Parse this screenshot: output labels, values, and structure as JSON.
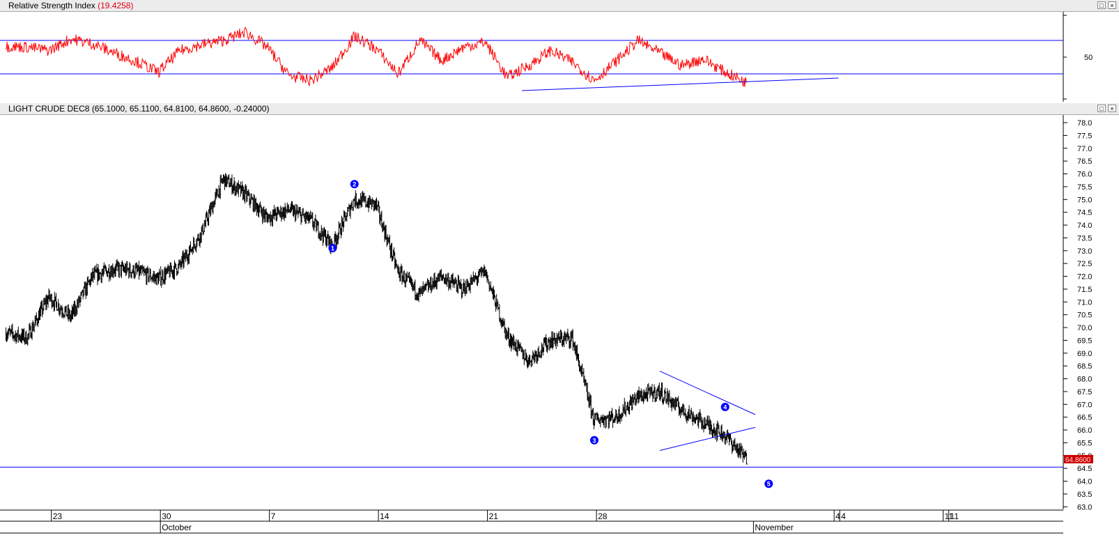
{
  "rsi_panel": {
    "title": "Relative Strength Index",
    "value_text": "(19.4258)",
    "level_label": "50",
    "upper_level": 70,
    "lower_level": 30,
    "line_color": "#ff0000",
    "level_color": "#0000ff"
  },
  "price_panel": {
    "title": "LIGHT CRUDE DEC8",
    "ohlc_text": "(65.1000, 65.1100, 64.8100, 64.8600, -0.24000)",
    "last_price_tag": "64.8600",
    "tag_color": "#cc0000"
  },
  "window_buttons": {
    "restore": "□",
    "close": "×"
  },
  "time_axis": {
    "day_labels": [
      "23",
      "30",
      "7",
      "14",
      "21",
      "28",
      "4",
      "4",
      "11",
      "11"
    ],
    "month_labels": [
      "October",
      "November"
    ]
  },
  "chart_data": {
    "type": "line",
    "title": "LIGHT CRUDE DEC8",
    "y_tick_labels": [
      "63.0",
      "63.5",
      "64.0",
      "64.5",
      "65.0",
      "65.5",
      "66.0",
      "66.5",
      "67.0",
      "67.5",
      "68.0",
      "68.5",
      "69.0",
      "69.5",
      "70.0",
      "70.5",
      "71.0",
      "71.5",
      "72.0",
      "72.5",
      "73.0",
      "73.5",
      "74.0",
      "74.5",
      "75.0",
      "75.5",
      "76.0",
      "76.5",
      "77.0",
      "77.5",
      "78.0"
    ],
    "ylim": [
      62.9,
      78.3
    ],
    "grid": false,
    "series": [
      {
        "values_by_session": [
          {
            "day": "Sep 19",
            "close": 69.8
          },
          {
            "day": "Sep 20",
            "close": 69.6
          },
          {
            "day": "Sep 21",
            "close": 71.2
          },
          {
            "day": "Sep 24",
            "close": 70.4
          },
          {
            "day": "Sep 25",
            "close": 72.0
          },
          {
            "day": "Sep 26",
            "close": 72.3
          },
          {
            "day": "Sep 27",
            "close": 72.2
          },
          {
            "day": "Sep 28",
            "close": 71.9
          },
          {
            "day": "Oct 1",
            "close": 72.4
          },
          {
            "day": "Oct 2",
            "close": 73.7
          },
          {
            "day": "Oct 3",
            "close": 75.8
          },
          {
            "day": "Oct 4",
            "close": 75.2
          },
          {
            "day": "Oct 5",
            "close": 74.3
          },
          {
            "day": "Oct 8",
            "close": 74.6
          },
          {
            "day": "Oct 9",
            "close": 74.2
          },
          {
            "day": "Oct 10",
            "close": 73.2
          },
          {
            "day": "Oct 11",
            "close": 75.0
          },
          {
            "day": "Oct 12",
            "close": 74.8
          },
          {
            "day": "Oct 15",
            "close": 72.2
          },
          {
            "day": "Oct 16",
            "close": 71.3
          },
          {
            "day": "Oct 17",
            "close": 72.0
          },
          {
            "day": "Oct 18",
            "close": 71.5
          },
          {
            "day": "Oct 19",
            "close": 72.2
          },
          {
            "day": "Oct 22",
            "close": 69.7
          },
          {
            "day": "Oct 23",
            "close": 68.7
          },
          {
            "day": "Oct 24",
            "close": 69.5
          },
          {
            "day": "Oct 25",
            "close": 69.6
          },
          {
            "day": "Oct 26",
            "close": 66.4
          },
          {
            "day": "Oct 29",
            "close": 66.5
          },
          {
            "day": "Oct 30",
            "close": 67.3
          },
          {
            "day": "Oct 31",
            "close": 67.5
          },
          {
            "day": "Nov 1",
            "close": 66.8
          },
          {
            "day": "Nov 2",
            "close": 66.3
          },
          {
            "day": "Nov 5",
            "close": 65.8
          },
          {
            "day": "Nov 6",
            "close": 64.86
          }
        ]
      },
      {
        "values": [
          63.0,
          62.0,
          58.0,
          72.0,
          66.0,
          55.0,
          45.0,
          32.0,
          58.0,
          65.0,
          70.0,
          80.0,
          62.0,
          28.0,
          22.0,
          38.0,
          75.0,
          60.0,
          30.0,
          70.0,
          46.0,
          62.0,
          68.0,
          26.0,
          40.0,
          58.0,
          44.0,
          22.0,
          45.0,
          70.0,
          55.0,
          40.0,
          48.0,
          32.0,
          19.43
        ]
      }
    ],
    "wave_labels": [
      {
        "label": "1",
        "day": "Oct 10",
        "value": 73.1
      },
      {
        "label": "2",
        "day": "Oct 11",
        "value": 75.6
      },
      {
        "label": "3",
        "day": "Oct 26",
        "value": 65.6
      },
      {
        "label": "4",
        "day": "Nov 5",
        "value": 66.9
      },
      {
        "label": "5",
        "day": "Nov 7",
        "value": 63.9
      }
    ],
    "horizontal_line": 64.55,
    "wedge_lines": [
      {
        "from": {
          "day": "Oct 31",
          "value": 68.3
        },
        "to": {
          "day": "Nov 6",
          "value": 66.6
        }
      },
      {
        "from": {
          "day": "Oct 31",
          "value": 65.2
        },
        "to": {
          "day": "Nov 6",
          "value": 66.1
        }
      }
    ],
    "rsi_trendline": {
      "from": {
        "day": "Oct 23",
        "value": 10
      },
      "to": {
        "day": "Nov 7",
        "value": 25
      }
    }
  }
}
